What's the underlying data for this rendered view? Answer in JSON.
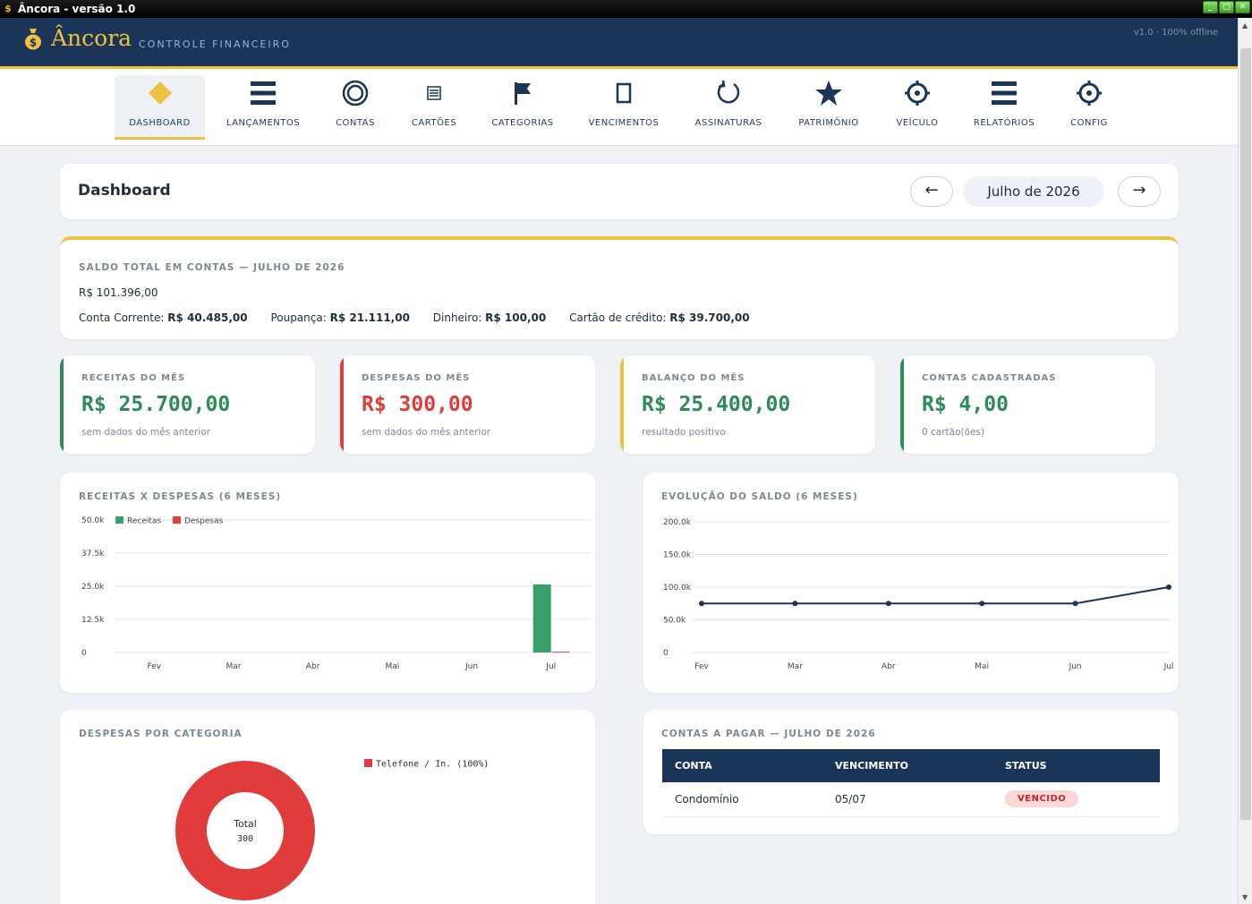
{
  "window": {
    "title": "Âncora - versão 1.0",
    "controls": [
      "_",
      "▢",
      "✕"
    ]
  },
  "header": {
    "logo": "Âncora",
    "subtitle": "CONTROLE FINANCEIRO",
    "version": "v1.0 · 100% offline"
  },
  "nav": [
    {
      "label": "DASHBOARD",
      "icon": "diamond-icon",
      "active": true
    },
    {
      "label": "LANÇAMENTOS",
      "icon": "list-icon"
    },
    {
      "label": "CONTAS",
      "icon": "circle-icon"
    },
    {
      "label": "CARTÕES",
      "icon": "card-icon"
    },
    {
      "label": "CATEGORIAS",
      "icon": "flag-icon"
    },
    {
      "label": "VENCIMENTOS",
      "icon": "calendar-icon"
    },
    {
      "label": "ASSINATURAS",
      "icon": "refresh-icon"
    },
    {
      "label": "PATRIMÔNIO",
      "icon": "star-icon"
    },
    {
      "label": "VEÍCULO",
      "icon": "gear-icon"
    },
    {
      "label": "RELATÓRIOS",
      "icon": "list-icon"
    },
    {
      "label": "CONFIG",
      "icon": "gear-icon"
    }
  ],
  "dashboard": {
    "title": "Dashboard",
    "prev": "←",
    "month": "Julho de 2026",
    "next": "→"
  },
  "saldo": {
    "label": "SALDO TOTAL EM CONTAS — JULHO DE 2026",
    "total": "R$ 101.396,00",
    "breakdown": [
      {
        "name": "Conta Corrente:",
        "value": "R$ 40.485,00"
      },
      {
        "name": "Poupança:",
        "value": "R$ 21.111,00"
      },
      {
        "name": "Dinheiro:",
        "value": "R$ 100,00"
      },
      {
        "name": "Cartão de crédito:",
        "value": "R$ 39.700,00"
      }
    ]
  },
  "kpis": [
    {
      "label": "RECEITAS DO MÊS",
      "value": "R$ 25.700,00",
      "sub": "sem dados do mês anterior",
      "color": "#2e8b57"
    },
    {
      "label": "DESPESAS DO MÊS",
      "value": "R$ 300,00",
      "sub": "sem dados do mês anterior",
      "color": "#e03c3c"
    },
    {
      "label": "BALANÇO DO MÊS",
      "value": "R$ 25.400,00",
      "sub": "resultado positivo",
      "color": "#f0c040",
      "valueColor": "#2e8b57"
    },
    {
      "label": "CONTAS CADASTRADAS",
      "value": "R$ 4,00",
      "sub": "0 cartão(ões)",
      "color": "#2e8b57"
    }
  ],
  "bar_chart": {
    "label": "RECEITAS X DESPESAS (6 MESES)"
  },
  "line_chart": {
    "label": "EVOLUÇÃO DO SALDO (6 MESES)"
  },
  "pie_chart": {
    "label": "DESPESAS POR CATEGORIA",
    "center_label": "Total",
    "center_value": "300"
  },
  "chart_data": [
    {
      "type": "bar",
      "categories": [
        "Fev",
        "Mar",
        "Abr",
        "Mai",
        "Jun",
        "Jul"
      ],
      "series": [
        {
          "name": "Receitas",
          "values": [
            0,
            0,
            0,
            0,
            0,
            25700
          ],
          "color": "#38a169"
        },
        {
          "name": "Despesas",
          "values": [
            0,
            0,
            0,
            0,
            0,
            300
          ],
          "color": "#e03c3c"
        }
      ],
      "yticks": [
        "0",
        "12.5k",
        "25.0k",
        "37.5k",
        "50.0k"
      ],
      "ylim": [
        0,
        50000
      ],
      "legend": "top-left",
      "grid": true
    },
    {
      "type": "line",
      "categories": [
        "Fev",
        "Mar",
        "Abr",
        "Mai",
        "Jun",
        "Jul"
      ],
      "series": [
        {
          "values": [
            75000,
            75000,
            75000,
            75000,
            75000,
            100000
          ],
          "color": "#1a3557"
        }
      ],
      "yticks": [
        "0",
        "50.0k",
        "100.0k",
        "150.0k",
        "200.0k"
      ],
      "ylim": [
        0,
        200000
      ],
      "grid": true
    },
    {
      "type": "pie",
      "slices": [
        {
          "label": "Telefone / In. (100%)",
          "value": 300,
          "color": "#e03c3c"
        }
      ]
    }
  ],
  "bills": {
    "label": "CONTAS A PAGAR — JULHO DE 2026",
    "columns": [
      "CONTA",
      "VENCIMENTO",
      "STATUS"
    ],
    "rows": [
      {
        "conta": "Condomínio",
        "vencimento": "05/07",
        "status": "VENCIDO"
      }
    ]
  }
}
